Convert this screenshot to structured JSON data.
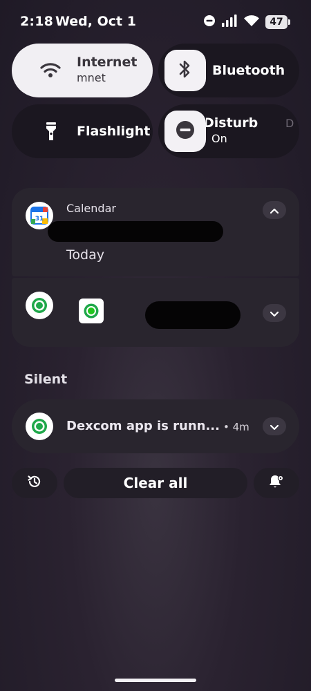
{
  "status_bar": {
    "time": "2:18",
    "date": "Wed, Oct 1",
    "battery": "47",
    "icons": [
      "do-not-disturb-icon",
      "signal-icon",
      "wifi-icon",
      "battery-icon"
    ]
  },
  "quick_settings": {
    "internet": {
      "title": "Internet",
      "subtitle": "mnet",
      "icon": "wifi-icon",
      "active": true
    },
    "bluetooth": {
      "title": "Bluetooth",
      "icon": "bluetooth-icon",
      "active": false
    },
    "flashlight": {
      "title": "Flashlight",
      "icon": "flashlight-icon",
      "active": false
    },
    "dnd": {
      "title": "Disturb",
      "subtitle": "On",
      "clipped_next": "D",
      "icon": "do-not-disturb-icon",
      "active": true
    }
  },
  "notifications": {
    "calendar": {
      "app_name": "Calendar",
      "icon_text": "31",
      "body": "Today",
      "expanded": true
    },
    "dexcom_group": {
      "icon": "dexcom-icon",
      "expanded": false
    }
  },
  "silent_section": {
    "label": "Silent",
    "dexcom": {
      "title": "Dexcom app is runn...",
      "time": "• 4m"
    }
  },
  "actions": {
    "history_icon": "history-icon",
    "clear_all": "Clear all",
    "settings_icon": "notification-settings-icon"
  },
  "colors": {
    "tile_active": "#f1eff3",
    "tile_inactive": "#1b1720",
    "card": "#29252e",
    "dexcom_green": "#1fa84a",
    "calendar_blue": "#1a73e8"
  }
}
